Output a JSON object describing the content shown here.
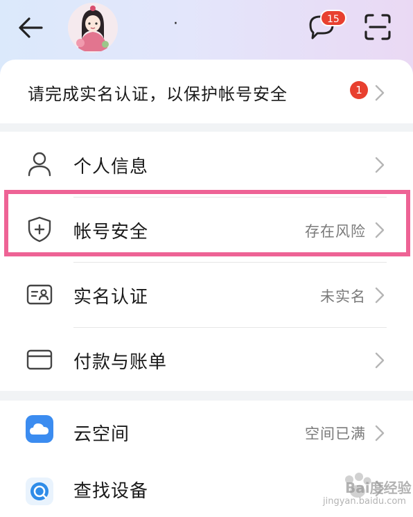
{
  "header": {
    "user_name": "·",
    "message_badge": "15",
    "icons": [
      "back-arrow-icon",
      "avatar",
      "chat-bubble-icon",
      "scan-icon"
    ]
  },
  "notice": {
    "text": "请完成实名认证，以保护帐号安全",
    "badge": "1"
  },
  "account_section": [
    {
      "label": "个人信息",
      "value": "",
      "icon": "person-icon"
    },
    {
      "label": "帐号安全",
      "value": "存在风险",
      "icon": "shield-plus-icon"
    },
    {
      "label": "实名认证",
      "value": "未实名",
      "icon": "id-card-icon"
    },
    {
      "label": "付款与账单",
      "value": "",
      "icon": "wallet-card-icon"
    }
  ],
  "services_section": [
    {
      "label": "云空间",
      "value": "空间已满",
      "icon": "cloud-icon"
    },
    {
      "label": "查找设备",
      "value": "",
      "icon": "find-device-icon"
    }
  ],
  "watermark": {
    "logo": "Bai度经验",
    "url": "jingyan.baidu.com"
  },
  "colors": {
    "highlight_border": "#ee6395",
    "badge_red": "#e8402f",
    "cloud_blue": "#3b8cf0"
  }
}
